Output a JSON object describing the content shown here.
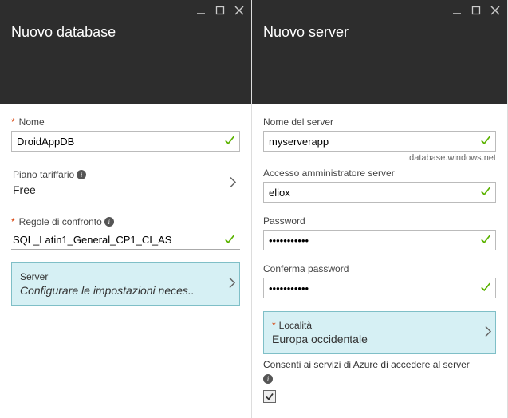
{
  "leftBlade": {
    "title": "Nuovo database",
    "name": {
      "label": "Nome",
      "required": true,
      "value": "DroidAppDB",
      "valid": true
    },
    "pricing": {
      "label": "Piano tariffario",
      "value": "Free"
    },
    "collation": {
      "label": "Regole di confronto",
      "required": true,
      "value": "SQL_Latin1_General_CP1_CI_AS",
      "valid": true
    },
    "server": {
      "label": "Server",
      "value": "Configurare le impostazioni neces.."
    }
  },
  "rightBlade": {
    "title": "Nuovo server",
    "serverName": {
      "label": "Nome del server",
      "value": "myserverapp",
      "suffix": ".database.windows.net",
      "valid": true
    },
    "adminLogin": {
      "label": "Accesso amministratore server",
      "value": "eliox",
      "valid": true
    },
    "password": {
      "label": "Password",
      "value": "•••••••••••",
      "valid": true
    },
    "confirmPassword": {
      "label": "Conferma password",
      "value": "•••••••••••",
      "valid": true
    },
    "location": {
      "label": "Località",
      "required": true,
      "value": "Europa occidentale"
    },
    "allowAzure": {
      "label": "Consenti ai servizi di Azure di accedere al server",
      "checked": true
    }
  }
}
